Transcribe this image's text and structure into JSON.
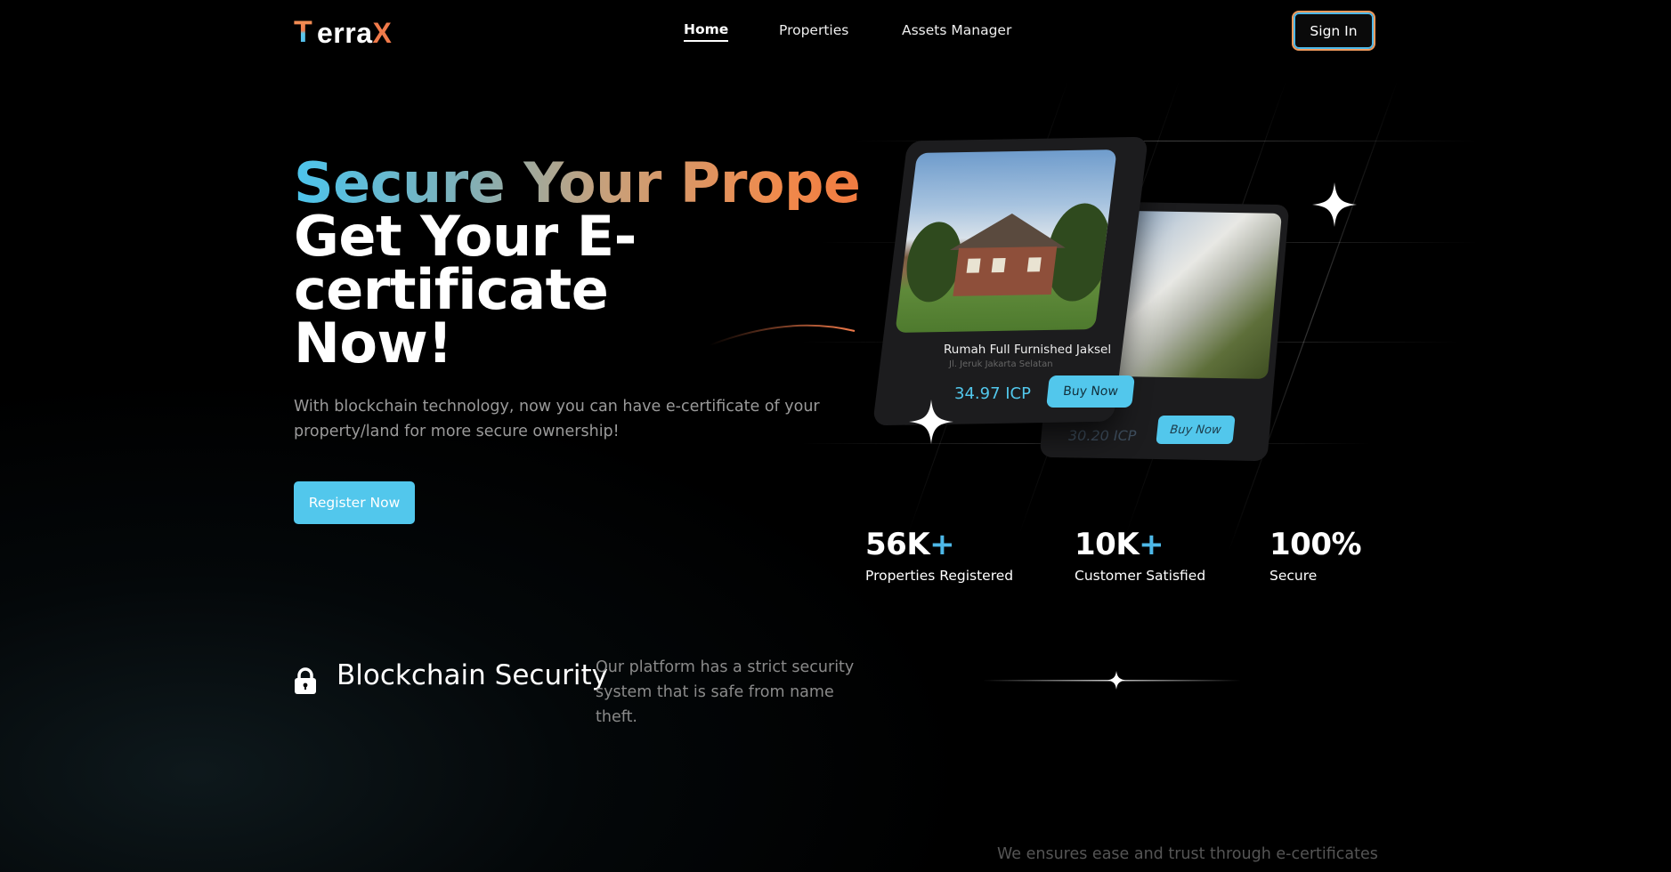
{
  "nav": {
    "logo": {
      "t": "T",
      "rest": "erra",
      "x": "X"
    },
    "links": [
      {
        "label": "Home",
        "active": true
      },
      {
        "label": "Properties",
        "active": false
      },
      {
        "label": "Assets Manager",
        "active": false
      }
    ],
    "sign_in": "Sign In"
  },
  "hero": {
    "line1": "Secure Your Property,",
    "line2": "Get Your E-certificate",
    "line3": "Now!",
    "description": "With blockchain technology, now you can have e-certificate of your property/land for more secure ownership!",
    "register": "Register Now"
  },
  "cards": {
    "front": {
      "title": "Rumah Full Furnished Jaksel",
      "address": "Jl. Jeruk Jakarta Selatan",
      "price": "34.97 ICP",
      "buy": "Buy Now"
    },
    "back": {
      "price": "30.20 ICP",
      "buy": "Buy Now"
    }
  },
  "stats": [
    {
      "value": "56K",
      "suffix": "+",
      "label": "Properties Registered"
    },
    {
      "value": "10K",
      "suffix": "+",
      "label": "Customer Satisfied"
    },
    {
      "value": "100%",
      "suffix": "",
      "label": "Secure"
    }
  ],
  "feature": {
    "icon": "lock-icon",
    "title": "Blockchain Security",
    "description": "Our platform has a strict security system that is safe from name theft."
  },
  "bottom_text": "We ensures ease and trust through e-certificates",
  "colors": {
    "accent_blue": "#52c7ec",
    "accent_orange": "#f07a4a",
    "background": "#000000"
  }
}
